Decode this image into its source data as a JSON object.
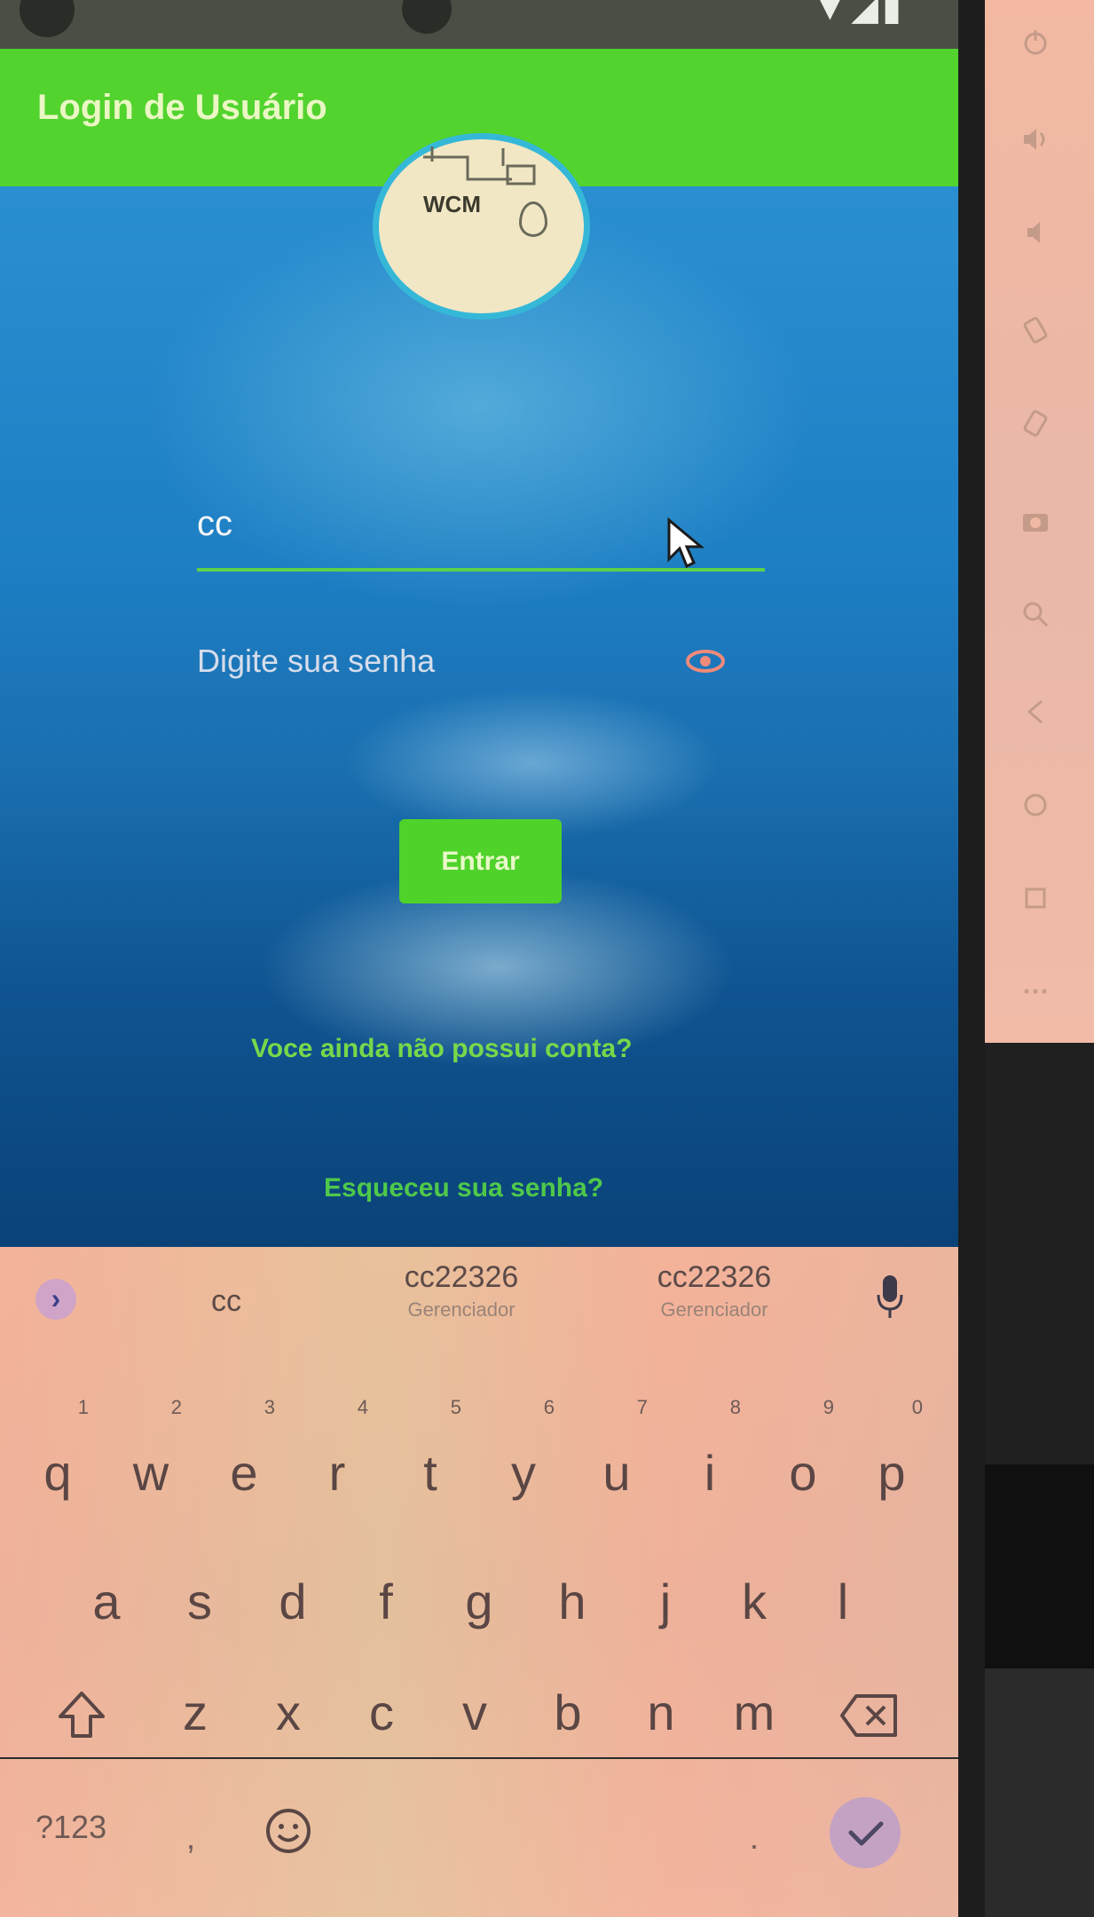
{
  "status_bar": {
    "time": "",
    "icons": [
      "wifi-icon",
      "signal-icon",
      "battery-icon"
    ]
  },
  "app_bar": {
    "title": "Login de Usuário"
  },
  "logo": {
    "text": "WCM"
  },
  "login_form": {
    "username_value": "cc",
    "password_placeholder": "Digite sua senha",
    "enter_label": "Entrar",
    "signup_prompt": "Voce ainda não possui conta?",
    "forgot_link": "Esqueceu sua senha?"
  },
  "keyboard": {
    "suggestions": [
      {
        "main": "cc",
        "sub": ""
      },
      {
        "main": "cc22326",
        "sub": "Gerenciador"
      },
      {
        "main": "cc22326",
        "sub": "Gerenciador"
      }
    ],
    "row1": [
      "q",
      "w",
      "e",
      "r",
      "t",
      "y",
      "u",
      "i",
      "o",
      "p"
    ],
    "row1_hints": [
      "1",
      "2",
      "3",
      "4",
      "5",
      "6",
      "7",
      "8",
      "9",
      "0"
    ],
    "row2": [
      "a",
      "s",
      "d",
      "f",
      "g",
      "h",
      "j",
      "k",
      "l"
    ],
    "row3": [
      "z",
      "x",
      "c",
      "v",
      "b",
      "n",
      "m"
    ],
    "symbols_label": "?123",
    "comma_label": ",",
    "period_label": "."
  },
  "colors": {
    "app_bar": "#52d32e",
    "accent_green": "#4fd22a",
    "input_underline": "#5cd14a",
    "keyboard_bg": "#efb59c"
  }
}
